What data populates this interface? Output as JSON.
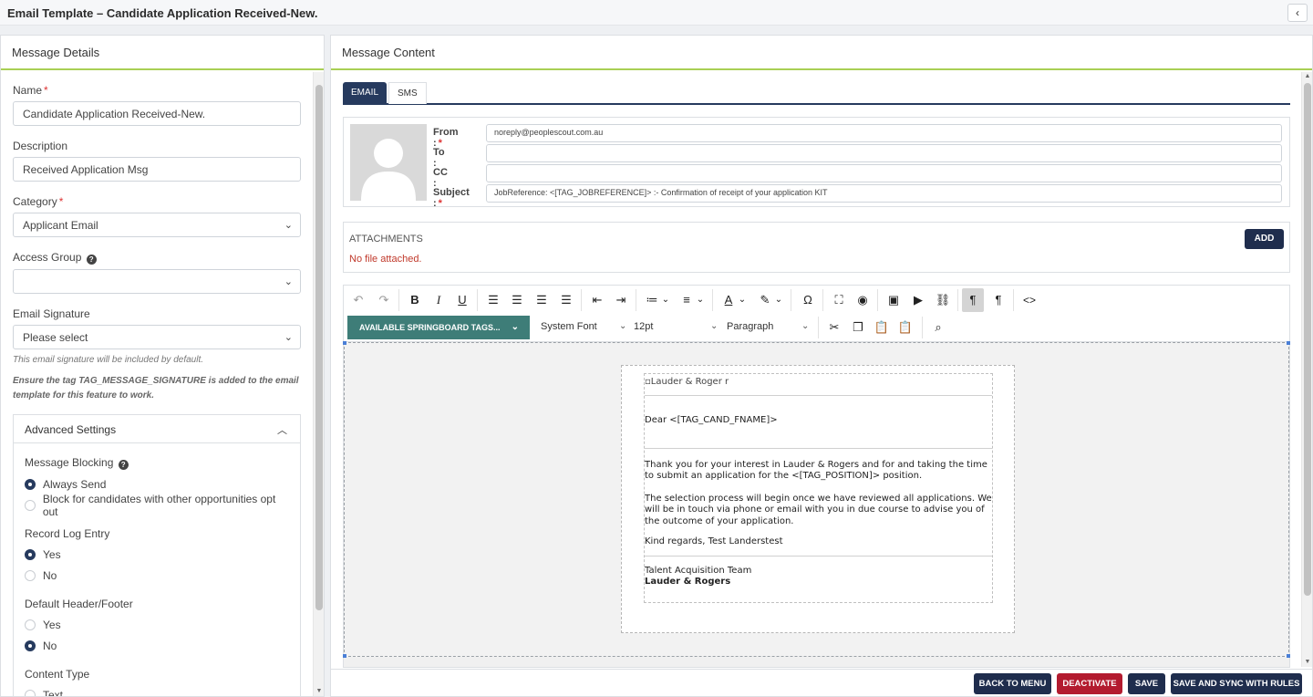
{
  "page": {
    "title": "Email Template – Candidate Application Received-New.",
    "collapse_icon": "chevron-left-icon"
  },
  "left": {
    "header": "Message Details",
    "name": {
      "label": "Name",
      "value": "Candidate Application Received-New."
    },
    "description": {
      "label": "Description",
      "value": "Received Application Msg"
    },
    "category": {
      "label": "Category",
      "value": "Applicant Email"
    },
    "access_group": {
      "label": "Access Group",
      "value": ""
    },
    "signature": {
      "label": "Email Signature",
      "value": "Please select",
      "hint": "This email signature will be included by default.",
      "note": "Ensure the tag TAG_MESSAGE_SIGNATURE is added to the email template for this feature to work."
    },
    "advanced": {
      "title": "Advanced Settings",
      "message_blocking": {
        "label": "Message Blocking",
        "options": [
          "Always Send",
          "Block for candidates with other opportunities opt out"
        ],
        "selected": 0
      },
      "record_log": {
        "label": "Record Log Entry",
        "options": [
          "Yes",
          "No"
        ],
        "selected": 0
      },
      "header_footer": {
        "label": "Default Header/Footer",
        "options": [
          "Yes",
          "No"
        ],
        "selected": 1
      },
      "content_type": {
        "label": "Content Type",
        "options": [
          "Text"
        ]
      }
    }
  },
  "right": {
    "header": "Message Content",
    "tabs": [
      "EMAIL",
      "SMS"
    ],
    "from": {
      "label": "From :",
      "value": "noreply@peoplescout.com.au"
    },
    "to": {
      "label": "To :",
      "value": ""
    },
    "cc": {
      "label": "CC :",
      "value": ""
    },
    "subject": {
      "label": "Subject :",
      "value": "JobReference: <[TAG_JOBREFERENCE]> :- Confirmation of receipt of your application KIT"
    },
    "attachments": {
      "title": "ATTACHMENTS",
      "empty": "No file attached.",
      "add_label": "ADD"
    },
    "editor": {
      "tags_label": "AVAILABLE SPRINGBOARD TAGS...",
      "font": "System Font",
      "size": "12pt",
      "block": "Paragraph"
    },
    "email": {
      "logo_alt": "Lauder & Roger r",
      "greeting": "Dear <[TAG_CAND_FNAME]>",
      "para1": "Thank you for your interest in Lauder & Rogers and for and taking the time to submit an application for the <[TAG_POSITION]> position.",
      "para2": "The selection process will begin once we have reviewed all applications. We will be in touch via phone or email with you in due course to advise you of the outcome of your application.",
      "closing": "Kind regards, Test Landerstest",
      "team": "Talent Acquisition Team",
      "brand": "Lauder & Rogers"
    }
  },
  "footer": {
    "back": "BACK TO MENU",
    "deactivate": "DEACTIVATE",
    "save": "SAVE",
    "save_sync": "SAVE AND SYNC WITH RULES",
    "colors": {
      "dark": "#1f2d4d",
      "danger": "#b31b2f"
    }
  }
}
